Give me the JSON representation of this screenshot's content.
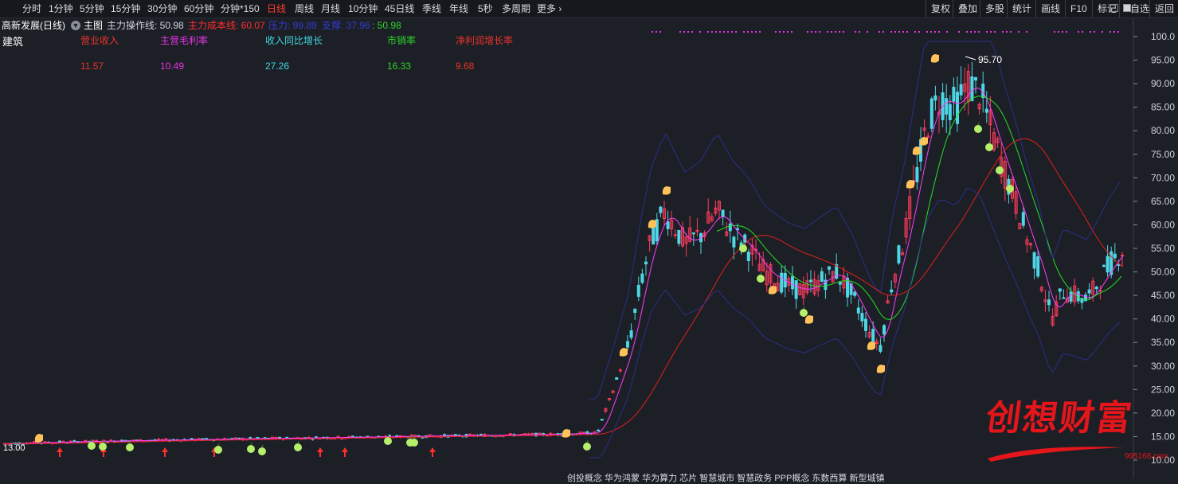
{
  "toolbar": {
    "left_items": [
      {
        "label": "分时",
        "active": false
      },
      {
        "label": "1分钟",
        "active": false
      },
      {
        "label": "5分钟",
        "active": false
      },
      {
        "label": "15分钟",
        "active": false
      },
      {
        "label": "30分钟",
        "active": false
      },
      {
        "label": "60分钟",
        "active": false
      },
      {
        "label": "分钟*150",
        "active": false
      },
      {
        "label": "日线",
        "active": true
      },
      {
        "label": "周线",
        "active": false
      },
      {
        "label": "月线",
        "active": false
      },
      {
        "label": "10分钟",
        "active": false
      },
      {
        "label": "45日线",
        "active": false
      },
      {
        "label": "季线",
        "active": false
      },
      {
        "label": "年线",
        "active": false
      },
      {
        "label": "5秒",
        "active": false
      },
      {
        "label": "多周期",
        "active": false
      },
      {
        "label": "更多 ›",
        "active": false
      }
    ],
    "right_items": [
      "复权",
      "叠加",
      "多股",
      "统计",
      "画线",
      "F10",
      "标记",
      "+自选",
      "返回"
    ]
  },
  "header": {
    "title": "高新发展(日线)",
    "main_chart": "主图",
    "indicators": [
      {
        "label": "主力操作线: 50.98",
        "color": "#cfd3dc"
      },
      {
        "label": "主力成本线: 60.07",
        "color": "#ff2d2d"
      },
      {
        "label": "压力: 99.89",
        "color": "#2f3dd6"
      },
      {
        "label": "支撑: 37.96",
        "color": "#2f3dd6"
      },
      {
        "label": ": 50.98",
        "color": "#2bd42b"
      }
    ]
  },
  "sector_label": "建筑",
  "financials": [
    {
      "label": "营业收入",
      "value": "11.57",
      "color": "#e8332b"
    },
    {
      "label": "主营毛利率",
      "value": "10.49",
      "color": "#e436e4"
    },
    {
      "label": "收入同比增长",
      "value": "27.26",
      "color": "#3fd6e0"
    },
    {
      "label": "市销率",
      "value": "16.33",
      "color": "#2bd42b"
    },
    {
      "label": "净利润增长率",
      "value": "9.68",
      "color": "#e8332b"
    }
  ],
  "chart": {
    "y_axis": {
      "min": 10,
      "max": 100,
      "ticks": [
        "100.0",
        "95.00",
        "90.00",
        "85.00",
        "80.00",
        "75.00",
        "70.00",
        "65.00",
        "60.00",
        "55.00",
        "50.00",
        "45.00",
        "40.00",
        "35.00",
        "30.00",
        "25.00",
        "20.00",
        "15.00",
        "10.00"
      ]
    },
    "high_label": "95.70",
    "low_label": "13.00"
  },
  "watermark": {
    "text": "创想财富",
    "url": "995168.com"
  },
  "bottom_text": "创投概念  华为鸿蒙  华为算力  芯片  智慧城市  智慧政务  PPP概念  东数西算  新型城镇",
  "colors": {
    "up": "#ff3b5c",
    "down": "#4fd6e6",
    "ma_fast": "#ff3cff",
    "ma_slow": "#e0201c",
    "ma_green": "#22e022",
    "band": "#2a2f8a"
  }
}
